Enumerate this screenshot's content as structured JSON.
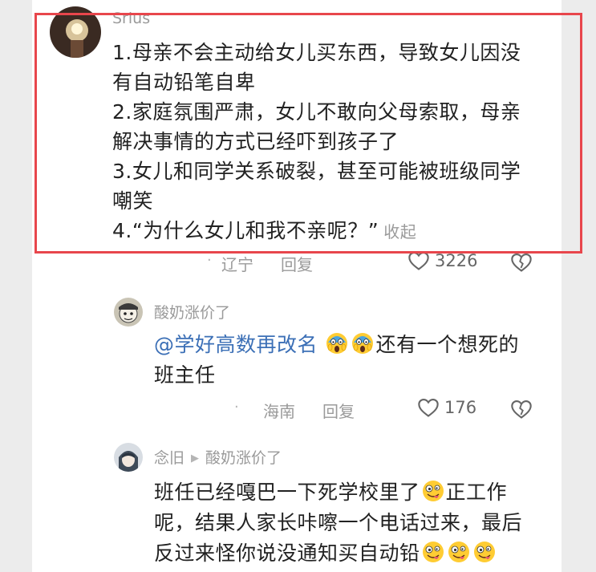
{
  "comment_main": {
    "username": "Srius",
    "lines": [
      "1.母亲不会主动给女儿买东西，导致女儿因没",
      "有自动铅笔自卑",
      "2.家庭氛围严肃，女儿不敢向父母索取，母亲",
      "解决事情的方式已经吓到孩子了",
      "3.女儿和同学关系破裂，甚至可能被班级同学",
      "嘲笑",
      "4.“为什么女儿和我不亲呢？”"
    ],
    "collapse_label": "收起",
    "location": "辽宁",
    "reply_label": "回复",
    "like_count": "3226"
  },
  "reply_1": {
    "username": "酸奶涨价了",
    "mention": "@学好高数再改名",
    "text_line1": "还有一个想死的",
    "text_line2": "班主任",
    "location": "海南",
    "reply_label": "回复",
    "like_count": "176"
  },
  "reply_2": {
    "username": "念旧",
    "reply_to": "酸奶涨价了",
    "text_line1_a": "班任已经嘎巴一下死学校里了",
    "text_line1_b": "正工作",
    "text_line2": "呢，结果人家长咔嚓一个电话过来，最后",
    "text_line3": "反过来怪你说没通知买自动铅"
  },
  "icons": {
    "like": "heart-outline-icon",
    "dislike": "broken-heart-icon",
    "scream_emoji": "scream-emoji-icon",
    "goofy_emoji": "goofy-face-emoji-icon"
  },
  "colors": {
    "highlight": "#e8464c",
    "mention": "#3b6fb6"
  }
}
